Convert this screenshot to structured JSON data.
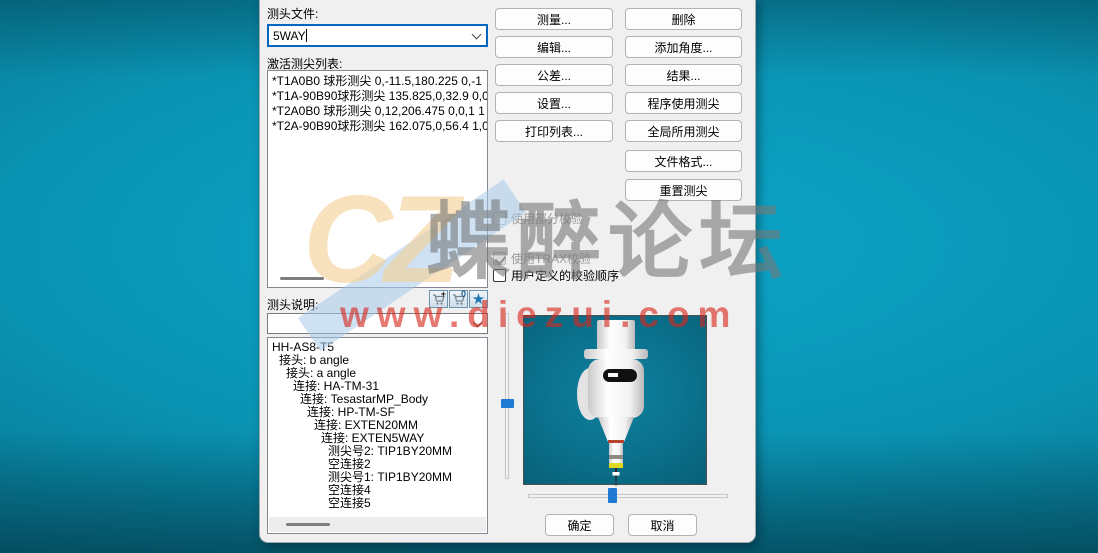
{
  "dialog": {
    "probe_file": {
      "label": "测头文件:",
      "value": "5WAY"
    },
    "active_tips": {
      "label": "激活测尖列表:",
      "items": [
        "*T1A0B0 球形测尖 0,-11.5,180.225 0,-1",
        "*T1A-90B90球形测尖 135.825,0,32.9 0,0",
        "*T2A0B0 球形测尖 0,12,206.475 0,0,1 1",
        "*T2A-90B90球形测尖 162.075,0,56.4 1,0"
      ]
    },
    "probe_description": {
      "label": "测头说明:",
      "combo_value": "",
      "tree": [
        "HH-AS8-T5",
        "接头: b angle",
        "接头: a angle",
        "连接: HA-TM-31",
        "连接: TesastarMP_Body",
        "连接: HP-TM-SF",
        "连接: EXTEN20MM",
        "连接: EXTEN5WAY",
        "测尖号2: TIP1BY20MM",
        "空连接2",
        "测尖号1: TIP1BY20MM",
        "空连接4",
        "空连接5"
      ]
    },
    "action_buttons": {
      "measure": "测量...",
      "delete": "删除",
      "edit": "编辑...",
      "add_angles": "添加角度...",
      "tolerances": "公差...",
      "results": "结果...",
      "setup": "设置...",
      "program_tips": "程序使用测尖",
      "print_list": "打印列表...",
      "global_tips": "全局所用测尖",
      "file_format": "文件格式...",
      "reset_tips": "重置测尖"
    },
    "checkboxes": {
      "partial_cal": {
        "label": "使用部分校验",
        "checked": false,
        "disabled": true
      },
      "trax_cal": {
        "label": "使用TRAX校验",
        "checked": true,
        "disabled": true
      },
      "user_order": {
        "label": "用户定义的校验顺序",
        "checked": false,
        "disabled": false
      }
    },
    "toolbar_icons": {
      "cart_add_glyph": "+",
      "cart_count_glyph": "0",
      "star_glyph": "★"
    },
    "footer": {
      "ok": "确定",
      "cancel": "取消"
    }
  },
  "watermark": {
    "logo": "CZ",
    "site": "蝶醉论坛",
    "url": "www.diezui.com",
    "url_color": "#d6261c",
    "site_color": "#767676",
    "logo_color": "#f4d096",
    "slash_color": "#a5caeb"
  },
  "colors": {
    "viewport_teal_light": "#0ca6c8",
    "viewport_teal_dark": "#045a70",
    "dialog_bg": "#f0f0f0",
    "focus_border": "#0067c0",
    "slider_accent": "#1f7ad4"
  }
}
